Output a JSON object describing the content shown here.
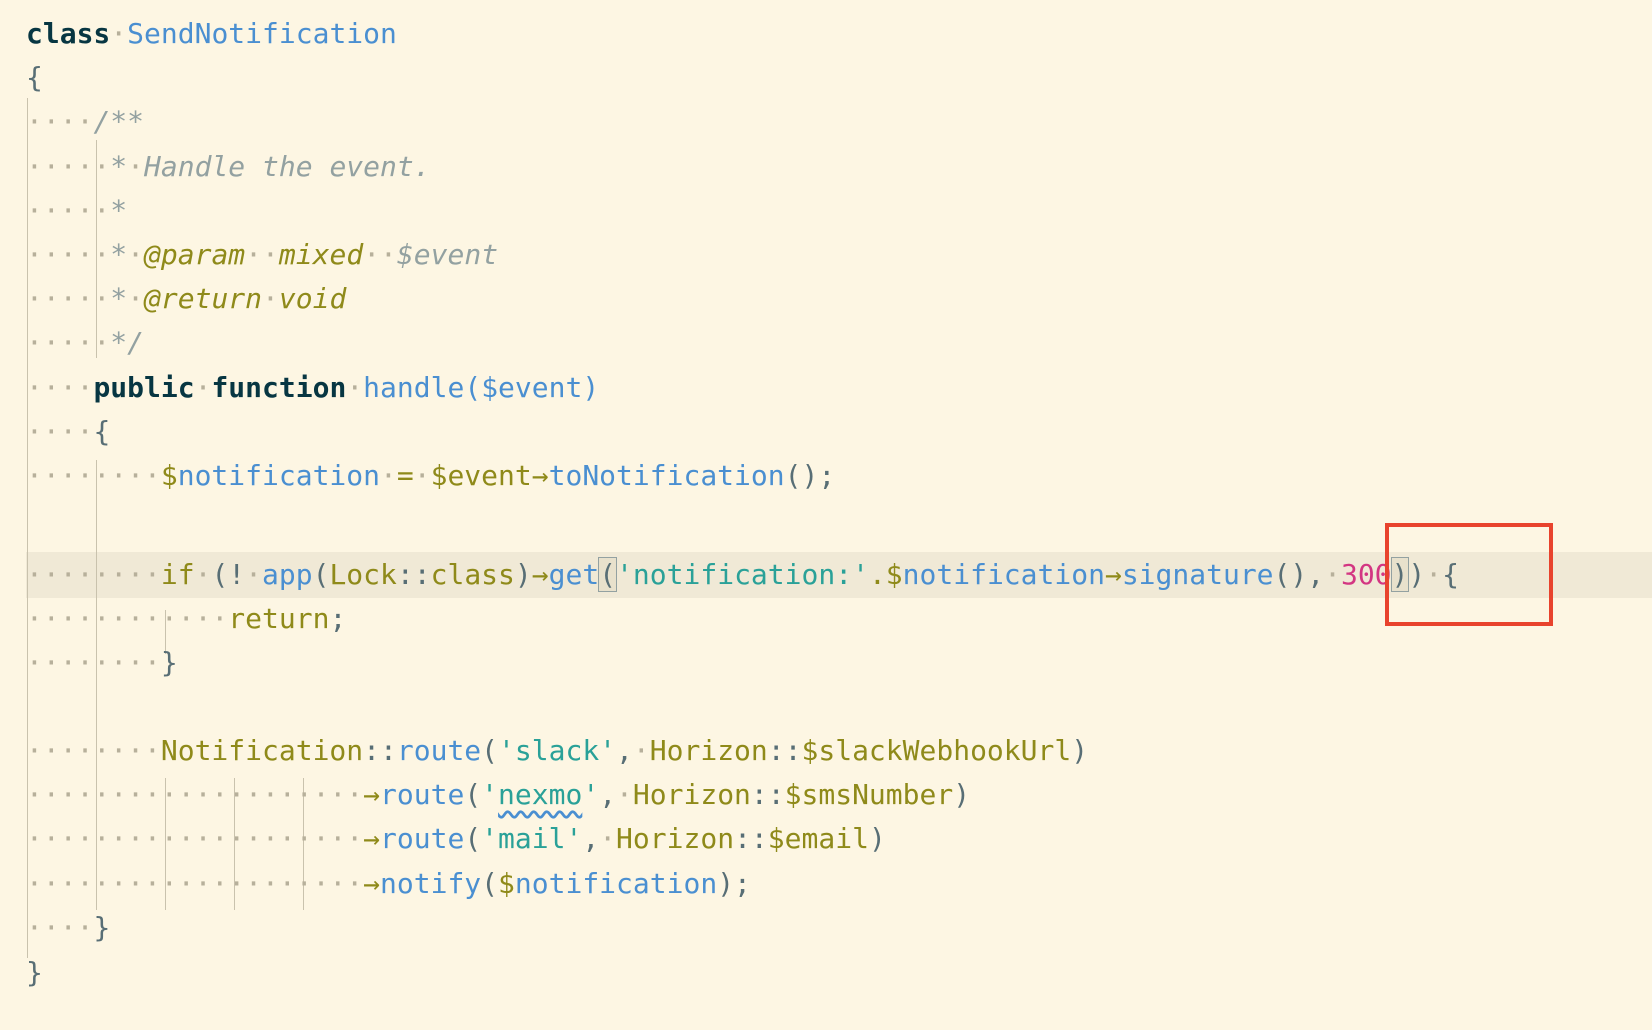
{
  "code": {
    "class_keyword": "class",
    "class_name": "SendNotification",
    "open_brace": "{",
    "doc_open": "/**",
    "doc_desc": "Handle the event.",
    "doc_star": "*",
    "doc_param_tag": "@param",
    "doc_param_type": "mixed",
    "doc_param_var": "$event",
    "doc_return_tag": "@return",
    "doc_return_type": "void",
    "doc_close": "*/",
    "public_kw": "public",
    "function_kw": "function",
    "method_name": "handle",
    "method_param": "$event",
    "line_assign_var": "notification",
    "line_assign_src": "event",
    "line_assign_call": "toNotification",
    "if_kw": "if",
    "app_fn": "app",
    "lock_class": "Lock",
    "class_const": "class",
    "get_fn": "get",
    "notif_string": "'notification:'",
    "notif_var": "notification",
    "signature_fn": "signature",
    "ttl_value": "300",
    "return_kw": "return",
    "notification_class": "Notification",
    "route_fn": "route",
    "slack_str": "'slack'",
    "horizon": "Horizon",
    "slack_var": "slackWebhookUrl",
    "nexmo_str": "nexmo",
    "sms_var": "smsNumber",
    "mail_str": "'mail'",
    "email_var": "email",
    "notify_fn": "notify",
    "close_brace": "}"
  },
  "colors": {
    "background": "#fdf6e3",
    "highlight_box": "#e8432d",
    "current_line": "#f0e9d6"
  }
}
